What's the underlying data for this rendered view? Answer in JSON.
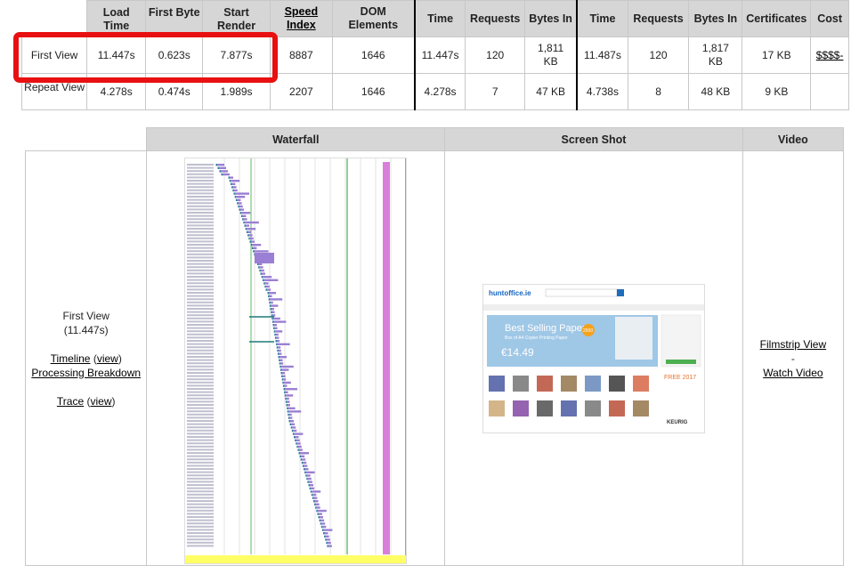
{
  "summary": {
    "headers": [
      "Load Time",
      "First Byte",
      "Start Render",
      "Speed Index",
      "DOM Elements",
      "Time",
      "Requests",
      "Bytes In",
      "Time",
      "Requests",
      "Bytes In",
      "Certificates",
      "Cost"
    ],
    "rows": [
      {
        "label": "First View",
        "load_time": "11.447s",
        "first_byte": "0.623s",
        "start_render": "7.877s",
        "speed_index": "8887",
        "dom_elements": "1646",
        "doc_time": "11.447s",
        "doc_requests": "120",
        "doc_bytes": "1,811 KB",
        "full_time": "11.487s",
        "full_requests": "120",
        "full_bytes": "1,817 KB",
        "certificates": "17 KB",
        "cost": "$$$$-"
      },
      {
        "label": "Repeat View",
        "load_time": "4.278s",
        "first_byte": "0.474s",
        "start_render": "1.989s",
        "speed_index": "2207",
        "dom_elements": "1646",
        "doc_time": "4.278s",
        "doc_requests": "7",
        "doc_bytes": "47 KB",
        "full_time": "4.738s",
        "full_requests": "8",
        "full_bytes": "48 KB",
        "certificates": "9 KB",
        "cost": ""
      }
    ]
  },
  "details": {
    "headers": {
      "waterfall": "Waterfall",
      "screenshot": "Screen Shot",
      "video": "Video"
    },
    "run_label": "First View",
    "run_time": "(11.447s)",
    "timeline": "Timeline",
    "timeline_view": "view",
    "processing": "Processing Breakdown",
    "trace": "Trace",
    "trace_view": "view",
    "filmstrip": "Filmstrip View",
    "dash": "-",
    "watch_video": "Watch Video"
  },
  "screenshot_page": {
    "logo": "huntoffice.ie",
    "banner_title": "Best Selling Paper",
    "banner_sub": "Box of A4 Copier Printing Paper",
    "banner_price": "€14.49",
    "banner_badge": "2500",
    "promo": "FREE 2017",
    "brand": "KEURIG"
  }
}
